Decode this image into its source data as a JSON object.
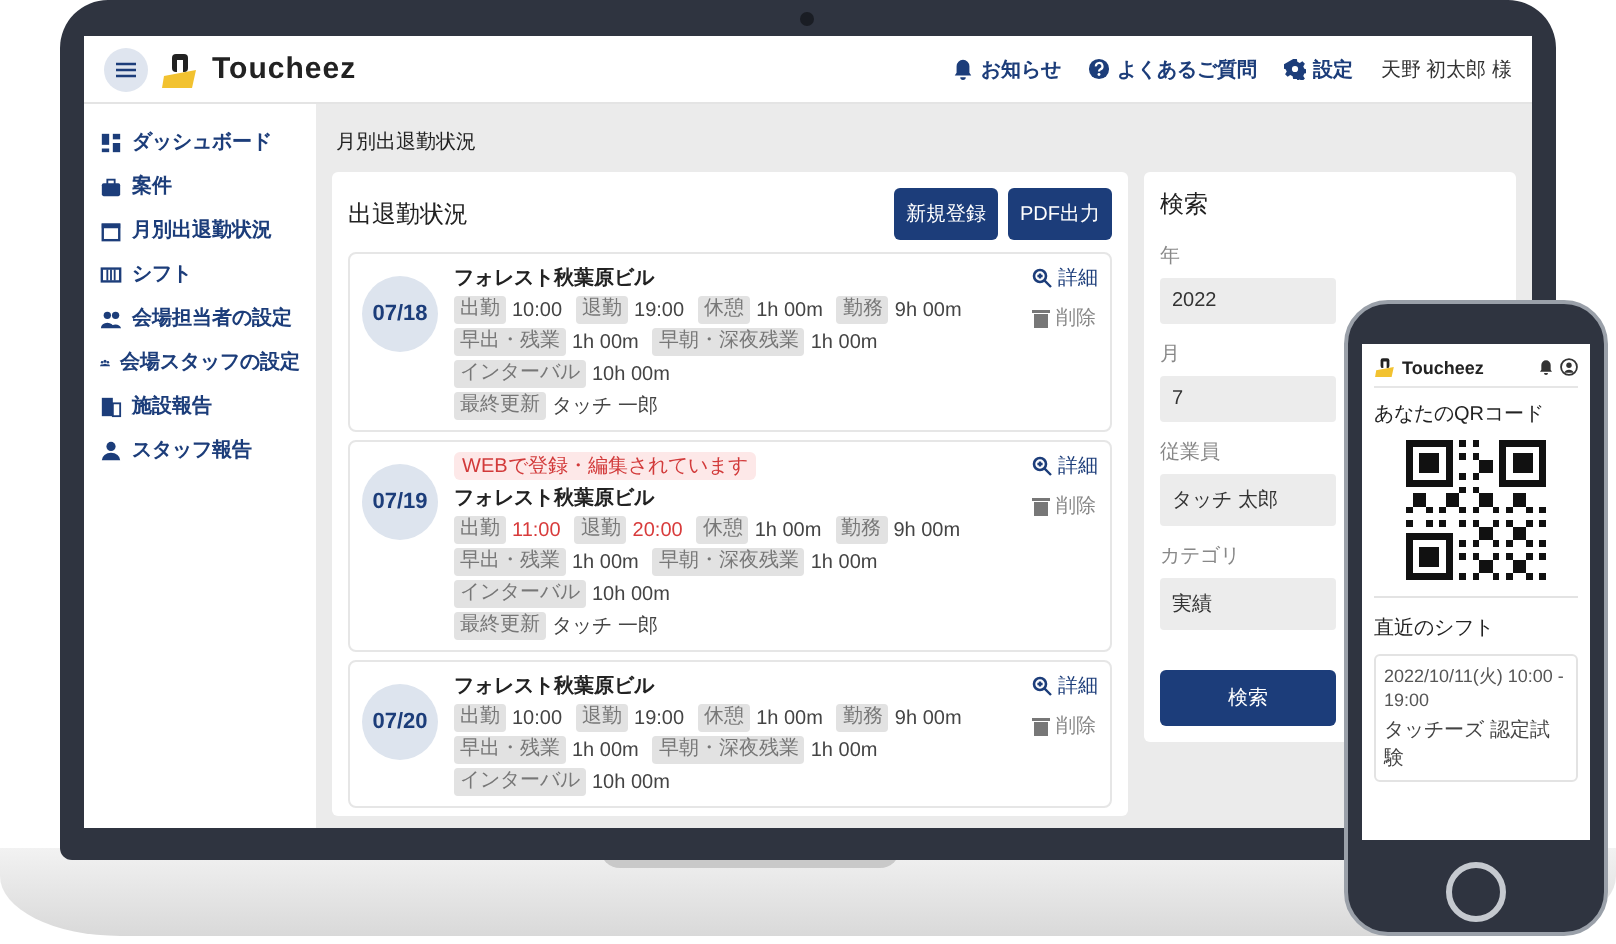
{
  "laptop": {
    "header": {
      "brand": "Toucheez",
      "links": [
        "お知らせ",
        "よくあるご質問",
        "設定"
      ],
      "user": "天野 初太郎 様"
    },
    "sidebar": {
      "items": [
        "ダッシュボード",
        "案件",
        "月別出退勤状況",
        "シフト",
        "会場担当者の設定",
        "会場スタッフの設定",
        "施設報告",
        "スタッフ報告"
      ]
    },
    "breadcrumb": "月別出退勤状況",
    "attendance": {
      "title": "出退勤状況",
      "buttons": [
        "新規登録",
        "PDF出力"
      ],
      "records": [
        {
          "date": "07/18",
          "site": "フォレスト秋葉原ビル",
          "actions": [
            "詳細",
            "削除"
          ],
          "lines": [
            [
              {
                "label": "出勤",
                "value": "10:00",
                "modified": false
              },
              {
                "label": "退勤",
                "value": "19:00",
                "modified": false
              },
              {
                "label": "休憩",
                "value": "1h 00m",
                "modified": false
              },
              {
                "label": "勤務",
                "value": "9h 00m",
                "modified": false
              }
            ],
            [
              {
                "label": "早出・残業",
                "value": "1h 00m",
                "modified": false
              },
              {
                "label": "早朝・深夜残業",
                "value": "1h 00m",
                "modified": false
              },
              {
                "label": "インターバル",
                "value": "10h 00m",
                "modified": false
              }
            ],
            [
              {
                "label": "最終更新",
                "value": "タッチ 一郎",
                "modified": false
              }
            ]
          ]
        },
        {
          "date": "07/19",
          "badge": "WEBで登録・編集されています",
          "site": "フォレスト秋葉原ビル",
          "actions": [
            "詳細",
            "削除"
          ],
          "lines": [
            [
              {
                "label": "出勤",
                "value": "11:00",
                "modified": true
              },
              {
                "label": "退勤",
                "value": "20:00",
                "modified": true
              },
              {
                "label": "休憩",
                "value": "1h 00m",
                "modified": false
              },
              {
                "label": "勤務",
                "value": "9h 00m",
                "modified": false
              }
            ],
            [
              {
                "label": "早出・残業",
                "value": "1h 00m",
                "modified": false
              },
              {
                "label": "早朝・深夜残業",
                "value": "1h 00m",
                "modified": false
              },
              {
                "label": "インターバル",
                "value": "10h 00m",
                "modified": false
              }
            ],
            [
              {
                "label": "最終更新",
                "value": "タッチ 一郎",
                "modified": false
              }
            ]
          ]
        },
        {
          "date": "07/20",
          "site": "フォレスト秋葉原ビル",
          "actions": [
            "詳細",
            "削除"
          ],
          "lines": [
            [
              {
                "label": "出勤",
                "value": "10:00",
                "modified": false
              },
              {
                "label": "退勤",
                "value": "19:00",
                "modified": false
              },
              {
                "label": "休憩",
                "value": "1h 00m",
                "modified": false
              },
              {
                "label": "勤務",
                "value": "9h 00m",
                "modified": false
              }
            ],
            [
              {
                "label": "早出・残業",
                "value": "1h 00m",
                "modified": false
              },
              {
                "label": "早朝・深夜残業",
                "value": "1h 00m",
                "modified": false
              },
              {
                "label": "インターバル",
                "value": "10h 00m",
                "modified": false
              }
            ]
          ]
        }
      ]
    },
    "search": {
      "title": "検索",
      "fields": [
        {
          "label": "年",
          "value": "2022"
        },
        {
          "label": "月",
          "value": "7"
        },
        {
          "label": "従業員",
          "value": "タッチ 太郎"
        },
        {
          "label": "カテゴリ",
          "value": "実績"
        }
      ],
      "button": "検索"
    }
  },
  "phone": {
    "brand": "Toucheez",
    "qr_title": "あなたのQRコード",
    "shifts_title": "直近のシフト",
    "shifts": [
      {
        "time": "2022/10/11(火) 10:00 - 19:00",
        "name": "タッチーズ 認定試験"
      }
    ]
  }
}
